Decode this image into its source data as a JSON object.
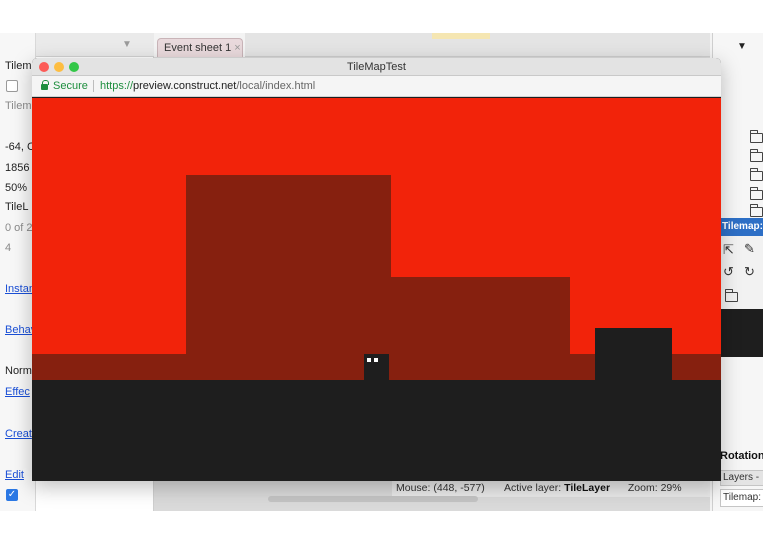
{
  "editor": {
    "left_panel": {
      "rows": [
        "Tilem",
        "Tilem",
        "-64, C",
        "1856",
        "50%",
        "TileL",
        "0 of 2",
        "4"
      ],
      "links": [
        "Instan",
        "Behav",
        "Effec",
        "Creat",
        "Edit"
      ],
      "normal_label": "Norm"
    },
    "event_tab": {
      "label": "Event sheet 1",
      "close": "×"
    },
    "right_panel": {
      "tilemap_header": "Tilemap: T",
      "rotation_label": "Rotation",
      "layers_tab": "Layers -",
      "tilemap_tab": "Tilemap:"
    },
    "status_bar": {
      "mouse_label": "Mouse:",
      "mouse_value": "(448, -577)",
      "active_layer_label": "Active layer:",
      "active_layer_value": "TileLayer",
      "zoom_label": "Zoom:",
      "zoom_value": "29%"
    }
  },
  "preview": {
    "window_title": "TileMapTest",
    "secure_label": "Secure",
    "url_scheme": "https://",
    "url_host": "preview.construct.net",
    "url_path": "/local/index.html"
  },
  "game": {
    "colors": {
      "sky": "#f2230a",
      "background_terrain": "#86200f",
      "foreground_terrain": "#1e1e1e",
      "player_eyes": "#ffffff"
    }
  },
  "icons": {
    "lock": "lock-icon",
    "folder": "folder-icon",
    "pointer": "pointer-icon",
    "pencil": "pencil-icon",
    "rotate_left": "rotate-left-icon",
    "rotate_right": "rotate-right-icon",
    "tree_arrow": "chevron-down-icon"
  }
}
